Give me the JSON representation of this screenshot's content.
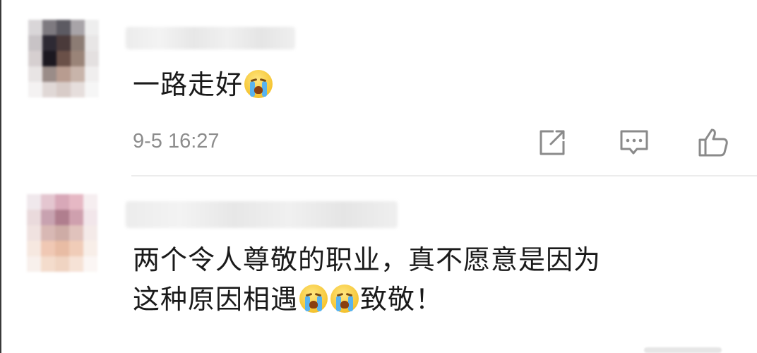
{
  "comments": [
    {
      "text": "一路走好",
      "emoji_after": [
        "crying-emoji"
      ],
      "timestamp": "9-5 16:27",
      "actions": [
        "share-icon",
        "reply-icon",
        "like-icon"
      ]
    },
    {
      "text_line1": "两个令人尊敬的职业，真不愿意是因为",
      "text_line2_before": "这种原因相遇",
      "text_line2_after": "致敬！",
      "emojis": [
        "crying-emoji",
        "crying-emoji"
      ]
    }
  ],
  "colors": {
    "timestamp": "#8c8c8c",
    "icon": "#8a8a8a",
    "divider": "#ececec"
  }
}
